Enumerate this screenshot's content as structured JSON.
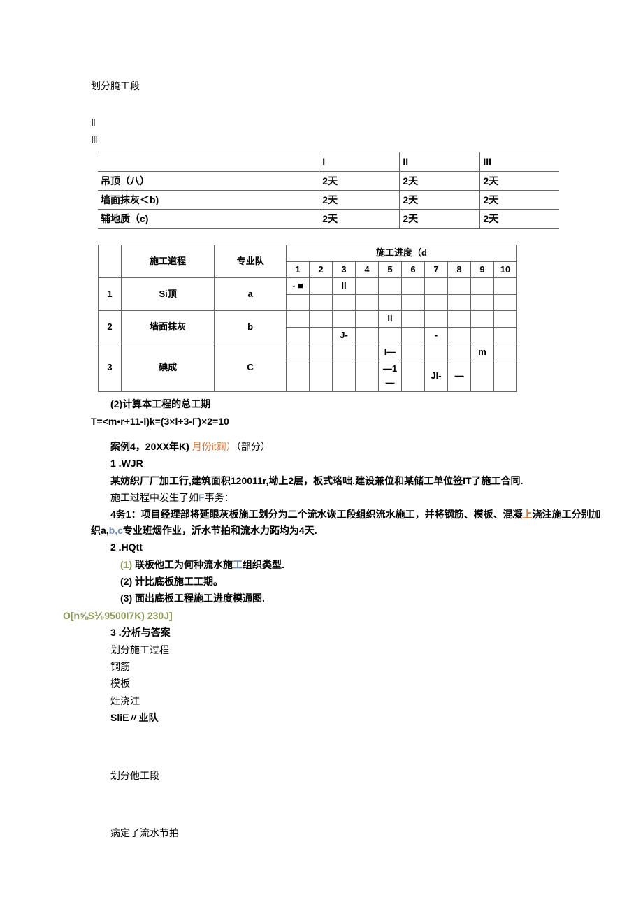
{
  "headings": {
    "divide_sections": "划分腌工段",
    "two": "Ⅱ",
    "three": "Ⅲ"
  },
  "table1": {
    "headers": [
      "",
      "I",
      "II",
      "III"
    ],
    "rows": [
      {
        "label": "吊顶（八）",
        "c1": "2天",
        "c2": "2天",
        "c3": "2天"
      },
      {
        "label": "墙面抹灰＜b)",
        "c1": "2天",
        "c2": "2天",
        "c3": "2天"
      },
      {
        "label": "辅地质（c)",
        "c1": "2天",
        "c2": "2天",
        "c3": "2天"
      }
    ]
  },
  "table2": {
    "group_proc": "施工道程",
    "team": "专业队",
    "sched": "施工进度（d",
    "nums": [
      "1",
      "2",
      "3",
      "4",
      "5",
      "6",
      "7",
      "8",
      "9",
      "10"
    ],
    "rows": [
      {
        "n": "1",
        "proc": "Si顶",
        "team": "a",
        "top": [
          "- ■",
          "",
          "II",
          "",
          "",
          "",
          "",
          "",
          "",
          ""
        ],
        "bot": [
          "",
          "",
          "",
          "",
          "",
          "",
          "",
          "",
          "",
          ""
        ]
      },
      {
        "n": "2",
        "proc": "墙面抹灰",
        "team": "b",
        "top": [
          "",
          "",
          "",
          "",
          "II",
          "",
          "",
          "",
          "",
          ""
        ],
        "bot": [
          "",
          "",
          "J-",
          "",
          "",
          "",
          "-",
          "",
          "",
          ""
        ]
      },
      {
        "n": "3",
        "proc": "碘成",
        "team": "C",
        "top": [
          "",
          "",
          "",
          "",
          "I—",
          "",
          "",
          "",
          "m",
          ""
        ],
        "bot": [
          "",
          "",
          "",
          "",
          "—1—",
          "",
          "JI-",
          "—",
          "",
          ""
        ]
      }
    ]
  },
  "body": {
    "line1": "(2)计算本工程的总工期",
    "line2": "T=<m•r+11-l)k=(3×l+3-Γ)×2=10",
    "line3a": "案例4，20XX年K) ",
    "line3b": "月份it麴）",
    "line3c": "（部分）",
    "line4": "1 .WJR",
    "line5": "某妨织厂厂加工行,建筑面积120011r,坳上2层，板式珞咄.建设兼位和某储工单位签IT了施工合同.",
    "line6a": "施工过程中发生了如",
    "line6b": "F",
    "line6c": "事务：",
    "line7a": "4务1：项目经理部将延眼灰板施工划分为二个流水诙工段组织流水施工，并将钢筋、模板、混凝",
    "line7b": "上",
    "line7c": "浇注施工分别加织a,",
    "line7d": "b,c",
    "line7e": "专业班烟作业，沂水节拍和流水力跖均为4天.",
    "line8": "2 .HQtt",
    "line9a": "(1)",
    "line9b": " 联板他工为何种流水施",
    "line9c": "工",
    "line9d": "组织类型.",
    "line10": "(2) 计比底板施工工期。",
    "line11": "(3) 面出底板工程施工进度模通图.",
    "line12": "O[n⅝S⅟₉9500I7K)  230J]",
    "line13": "3 .分析与答案",
    "line14": "划分施工过程",
    "line15": "钢筋",
    "line16": "模板",
    "line17": "灶浇注",
    "line18": "SliE〃业队",
    "line19": "划分他工段",
    "line20": "病定了流水节拍"
  }
}
